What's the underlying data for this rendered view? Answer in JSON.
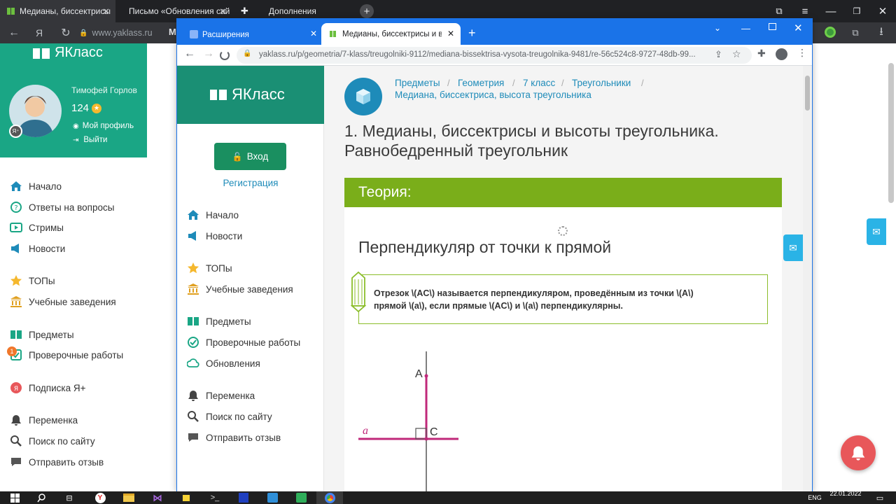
{
  "back_browser": {
    "tabs": [
      {
        "label": "Медианы, биссектрисы"
      },
      {
        "label": "Письмо «Обновления сай"
      },
      {
        "label": "Дополнения"
      }
    ],
    "address_text": "www.yaklass.ru",
    "address_tail": "M"
  },
  "bg_site": {
    "brand": "ЯКласс",
    "user_name": "Тимофей Горлов",
    "points": "124",
    "my_profile": "Мой профиль",
    "logout": "Выйти",
    "badge": "1",
    "nav": [
      "Начало",
      "Ответы на вопросы",
      "Стримы",
      "Новости",
      "ТОПы",
      "Учебные заведения",
      "Предметы",
      "Проверочные работы",
      "Подписка Я+",
      "Переменка",
      "Поиск по сайту",
      "Отправить отзыв"
    ]
  },
  "front_browser": {
    "tab_extensions": "Расширения",
    "tab_active": "Медианы, биссектрисы и высо",
    "url": "yaklass.ru/p/geometria/7-klass/treugolniki-9112/mediana-bissektrisa-vysota-treugolnika-9481/re-56c524c8-9727-48db-99..."
  },
  "page": {
    "brand": "ЯКласс",
    "login": "Вход",
    "register": "Регистрация",
    "nav": [
      "Начало",
      "Новости",
      "ТОПы",
      "Учебные заведения",
      "Предметы",
      "Проверочные работы",
      "Обновления",
      "Переменка",
      "Поиск по сайту",
      "Отправить отзыв"
    ],
    "breadcrumbs": [
      "Предметы",
      "Геометрия",
      "7 класс",
      "Треугольники",
      "Медиана, биссектриса, высота треугольника"
    ],
    "title_line1": "1. Медианы, биссектрисы и высоты треугольника.",
    "title_line2": "Равнобедренный треугольник",
    "theory_label": "Теория:",
    "section_title": "Перпендикуляр от точки к прямой",
    "definition_line1": "Отрезок \\(AC\\) называется перпендикуляром, проведённым из точки \\(A\\)",
    "definition_line2": "прямой \\(a\\), если прямые \\(AC\\) и \\(a\\) перпендикулярны.",
    "figure": {
      "label_a": "a",
      "label_A": "A",
      "label_C": "C"
    }
  },
  "taskbar": {
    "time": "21:49",
    "date": "22.01.2022",
    "lang": "ENG"
  },
  "colors": {
    "brand_green": "#1aa685",
    "theory_green": "#7aae1a",
    "link_blue": "#1e8bb9",
    "chrome_blue": "#1a73e8",
    "figure_magenta": "#c0287a",
    "bell_red": "#e8575a"
  }
}
